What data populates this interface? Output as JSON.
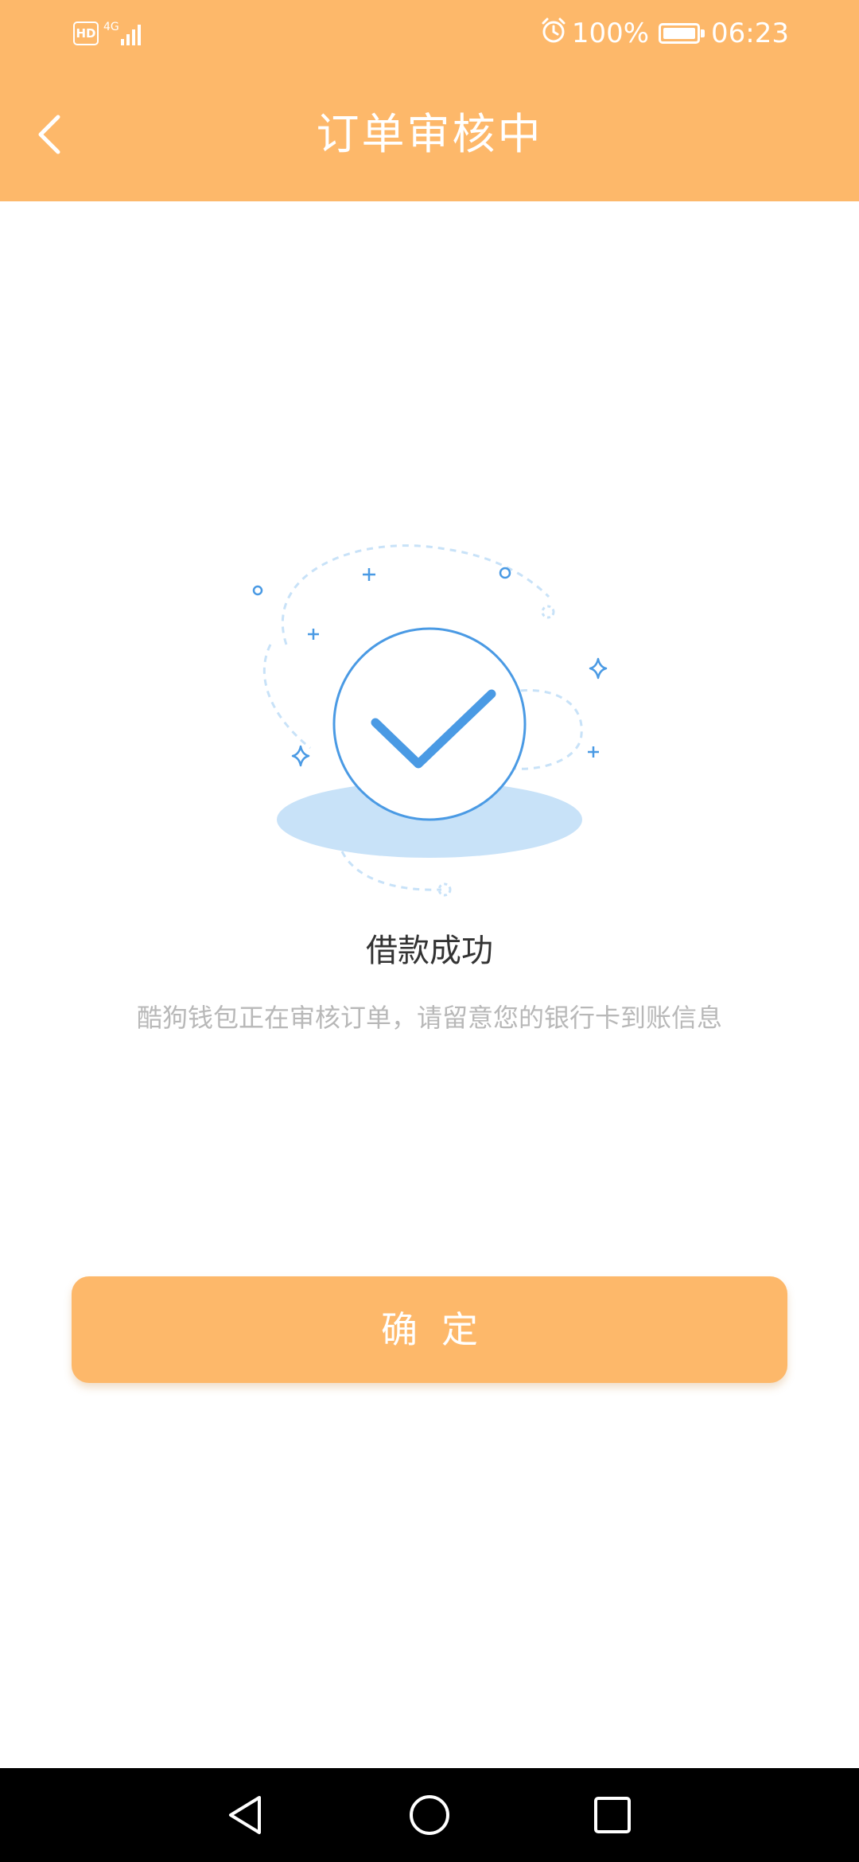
{
  "status_bar": {
    "hd_label": "HD",
    "network_label": "4G",
    "battery_percent": "100%",
    "time": "06:23",
    "battery_level": 1.0,
    "icons": [
      "alarm-icon",
      "battery-icon",
      "signal-icon"
    ]
  },
  "header": {
    "title": "订单审核中",
    "back_icon": "chevron-left-icon"
  },
  "result": {
    "title": "借款成功",
    "description": "酷狗钱包正在审核订单，请留意您的银行卡到账信息",
    "illustration_icon": "success-check-icon"
  },
  "actions": {
    "confirm_label": "确定"
  },
  "nav_bar": {
    "icons": [
      "nav-back-icon",
      "nav-home-icon",
      "nav-recents-icon"
    ]
  },
  "colors": {
    "accent": "#fdb86a",
    "illustration_blue": "#4a9ae4",
    "illustration_light": "#c8e2f8",
    "title_text": "#333333",
    "desc_text": "#b8b8b8"
  }
}
